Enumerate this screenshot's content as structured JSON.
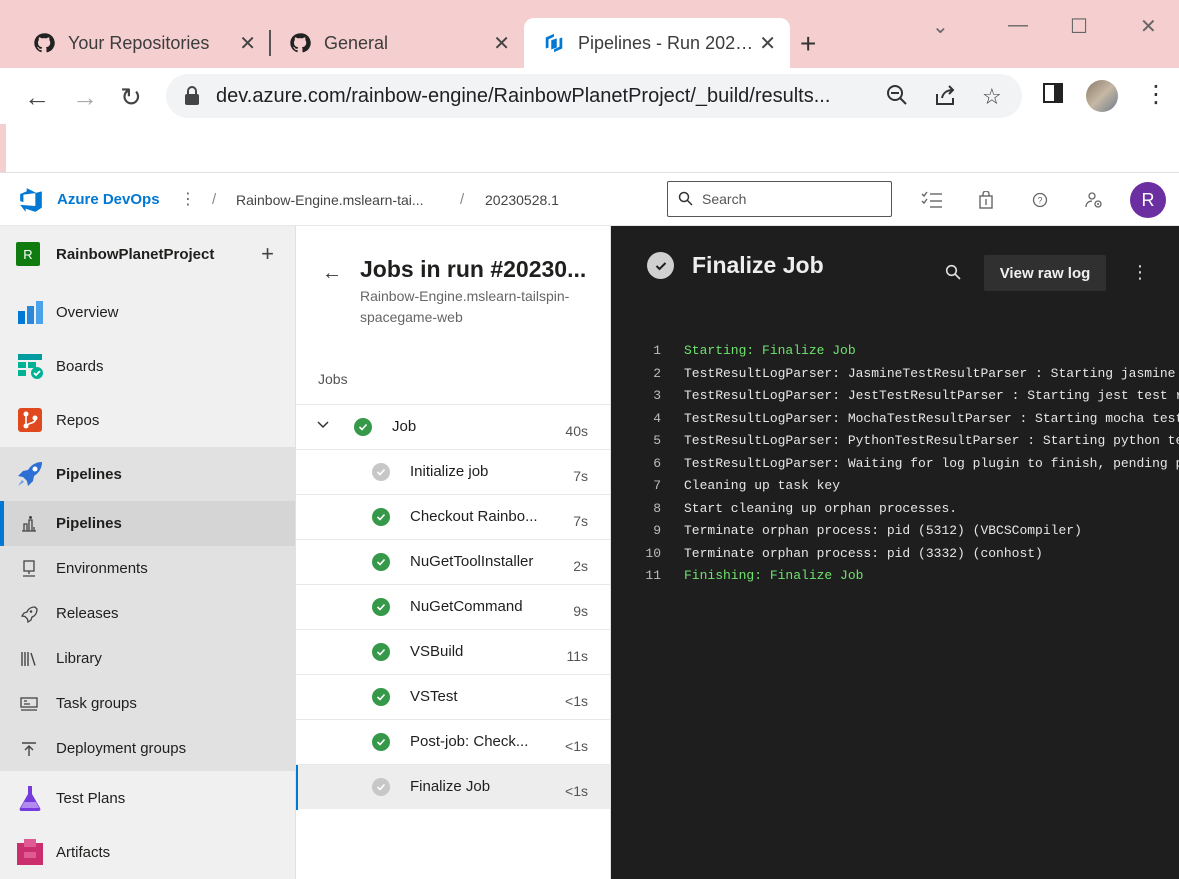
{
  "browser": {
    "tabs": [
      {
        "title": "Your Repositories",
        "icon": "github-icon"
      },
      {
        "title": "General",
        "icon": "github-icon"
      },
      {
        "title": "Pipelines - Run 202…",
        "icon": "azure-pipelines-icon",
        "active": true
      }
    ],
    "url": "dev.azure.com/rainbow-engine/RainbowPlanetProject/_build/results..."
  },
  "header": {
    "brand": "Azure DevOps",
    "breadcrumbs": [
      "Rainbow-Engine.mslearn-tai...",
      "20230528.1"
    ],
    "search_placeholder": "Search",
    "user_initial": "R"
  },
  "sidebar": {
    "project_initial": "R",
    "project_name": "RainbowPlanetProject",
    "items": [
      {
        "label": "Overview"
      },
      {
        "label": "Boards"
      },
      {
        "label": "Repos"
      },
      {
        "label": "Pipelines"
      }
    ],
    "pipeline_sub": [
      {
        "label": "Pipelines"
      },
      {
        "label": "Environments"
      },
      {
        "label": "Releases"
      },
      {
        "label": "Library"
      },
      {
        "label": "Task groups"
      },
      {
        "label": "Deployment groups"
      }
    ],
    "bottom_items": [
      {
        "label": "Test Plans"
      },
      {
        "label": "Artifacts"
      }
    ]
  },
  "jobs": {
    "title": "Jobs in run #20230...",
    "subtitle": "Rainbow-Engine.mslearn-tailspin-spacegame-web",
    "section_label": "Jobs",
    "job": {
      "name": "Job",
      "duration": "40s"
    },
    "steps": [
      {
        "name": "Initialize job",
        "duration": "7s",
        "status": "grey"
      },
      {
        "name": "Checkout Rainbo...",
        "duration": "7s",
        "status": "ok"
      },
      {
        "name": "NuGetToolInstaller",
        "duration": "2s",
        "status": "ok"
      },
      {
        "name": "NuGetCommand",
        "duration": "9s",
        "status": "ok"
      },
      {
        "name": "VSBuild",
        "duration": "11s",
        "status": "ok"
      },
      {
        "name": "VSTest",
        "duration": "<1s",
        "status": "ok"
      },
      {
        "name": "Post-job: Check...",
        "duration": "<1s",
        "status": "ok"
      },
      {
        "name": "Finalize Job",
        "duration": "<1s",
        "status": "grey"
      }
    ]
  },
  "log": {
    "title": "Finalize Job",
    "raw_button": "View raw log",
    "lines": [
      {
        "n": "1",
        "text": "Starting: Finalize Job",
        "green": true
      },
      {
        "n": "2",
        "text": "TestResultLogParser: JasmineTestResultParser : Starting jasmine test result parser."
      },
      {
        "n": "3",
        "text": "TestResultLogParser: JestTestResultParser : Starting jest test result parser."
      },
      {
        "n": "4",
        "text": "TestResultLogParser: MochaTestResultParser : Starting mocha test result parser."
      },
      {
        "n": "5",
        "text": "TestResultLogParser: PythonTestResultParser : Starting python test result parser."
      },
      {
        "n": "6",
        "text": "TestResultLogParser: Waiting for log plugin to finish, pending process."
      },
      {
        "n": "7",
        "text": "Cleaning up task key"
      },
      {
        "n": "8",
        "text": "Start cleaning up orphan processes."
      },
      {
        "n": "9",
        "text": "Terminate orphan process: pid (5312) (VBCSCompiler)"
      },
      {
        "n": "10",
        "text": "Terminate orphan process: pid (3332) (conhost)"
      },
      {
        "n": "11",
        "text": "Finishing: Finalize Job",
        "green": true
      }
    ]
  },
  "colors": {
    "accent": "#0078d4",
    "success": "#359949",
    "log_background": "#1e1e1e",
    "log_green": "#6ee36e",
    "avatar": "#6b2fa1"
  }
}
